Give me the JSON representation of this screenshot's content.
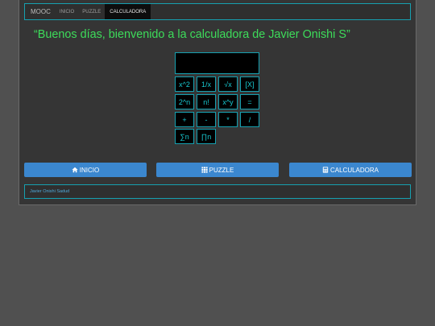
{
  "navbar": {
    "brand": "MOOC",
    "links": [
      {
        "label": "INICIO",
        "active": false
      },
      {
        "label": "PUZZLE",
        "active": false
      },
      {
        "label": "CALCULADORA",
        "active": true
      }
    ]
  },
  "greeting": "“Buenos días, bienvenido a la calculadora de Javier Onishi S”",
  "calculator": {
    "display": "",
    "keys": {
      "square": "x^2",
      "reciprocal": "1/x",
      "sqrt": "√x",
      "clear": "[X]",
      "pow2": "2^n",
      "factorial": "n!",
      "power": "x^y",
      "equals": "=",
      "plus": "+",
      "minus": "-",
      "multiply": "*",
      "divide": "/",
      "sum": "∑n",
      "product": "∏n"
    }
  },
  "buttons": {
    "inicio": "INICIO",
    "puzzle": "PUZZLE",
    "calculadora": "CALCULADORA"
  },
  "footer": "Javier Onishi Sadud",
  "colors": {
    "accent": "#16a0b0",
    "greeting": "#3ddc5a",
    "button": "#3b87cf"
  }
}
